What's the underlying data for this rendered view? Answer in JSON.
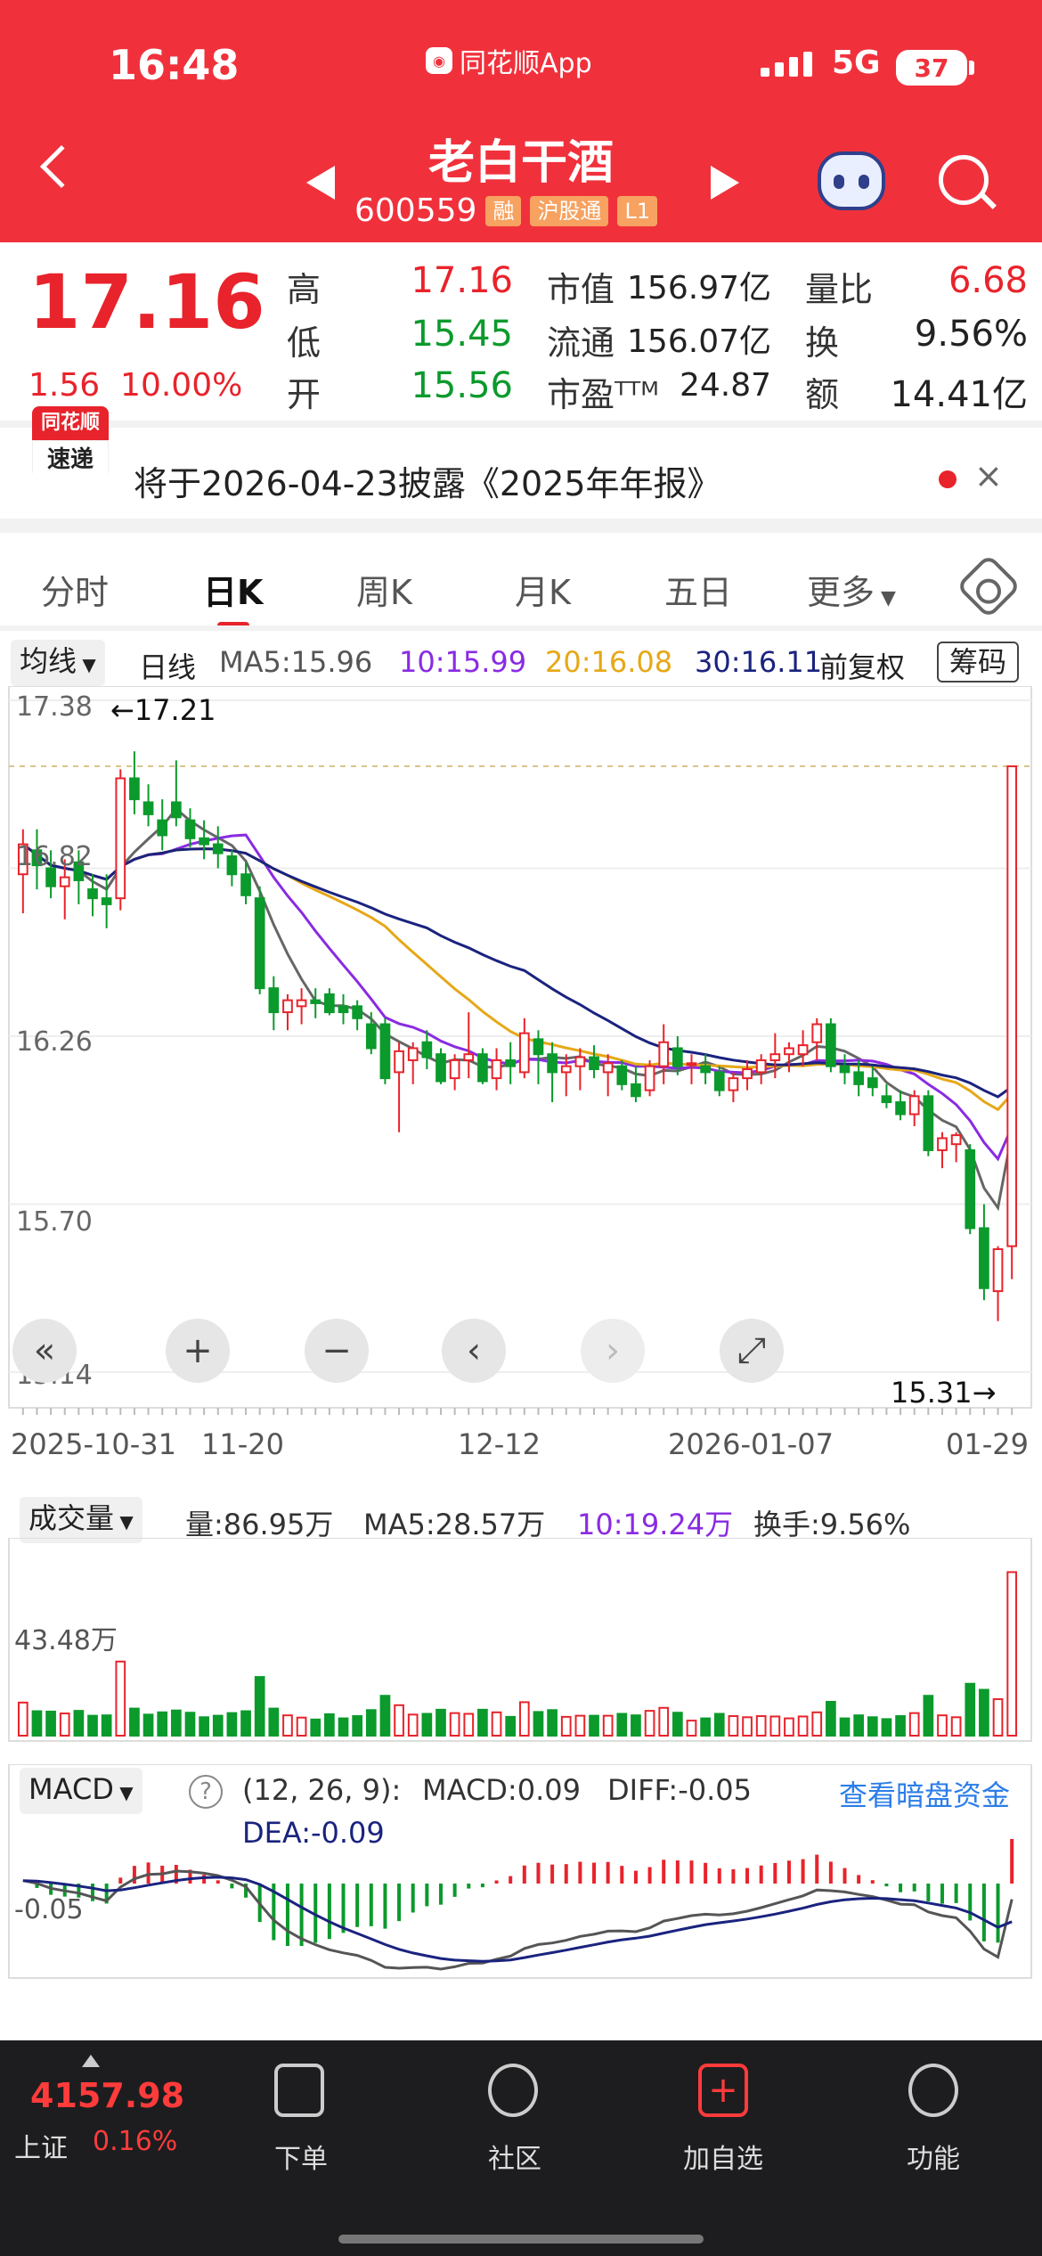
{
  "status_bar": {
    "time": "16:48",
    "app": "同花顺App",
    "network": "5G",
    "battery": "37"
  },
  "header": {
    "title": "老白干酒",
    "code": "600559",
    "tags": [
      "融",
      "沪股通",
      "L1"
    ]
  },
  "quote": {
    "price": "17.16",
    "change": "1.56",
    "change_pct": "10.00%",
    "high_label": "高",
    "high": "17.16",
    "low_label": "低",
    "low": "15.45",
    "open_label": "开",
    "open": "15.56",
    "mcap_label": "市值",
    "mcap": "156.97亿",
    "float_label": "流通",
    "float": "156.07亿",
    "pe_label": "市盈ᵀᵀᴹ",
    "pe": "24.87",
    "vr_label": "量比",
    "vr": "6.68",
    "turn_label": "换",
    "turn": "9.56%",
    "amt_label": "额",
    "amt": "14.41亿"
  },
  "announcement": {
    "logo_top": "同花顺",
    "logo_bottom": "速递",
    "text": "将于2026-04-23披露《2025年年报》",
    "close": "×"
  },
  "tabs": [
    "分时",
    "日K",
    "周K",
    "月K",
    "五日",
    "更多"
  ],
  "active_tab": "日K",
  "ma_bar": {
    "selector": "均线",
    "period": "日线",
    "ma5": "MA5:15.96",
    "ma10": "10:15.99",
    "ma20": "20:16.08",
    "ma30": "30:16.11",
    "adjust": "前复权",
    "chip_button": "筹码"
  },
  "kline_axis": {
    "y_ticks": [
      "17.38",
      "16.82",
      "16.26",
      "15.70",
      "15.14"
    ],
    "max_label": "←17.21",
    "min_label": "15.31→",
    "x_ticks": [
      "2025-10-31",
      "11-20",
      "12-12",
      "2026-01-07",
      "01-29"
    ]
  },
  "volume_bar": {
    "selector": "成交量",
    "vol": "量:86.95万",
    "ma5": "MA5:28.57万",
    "ma10": "10:19.24万",
    "turnover": "换手:9.56%",
    "y_tick": "43.48万"
  },
  "macd_bar": {
    "selector": "MACD",
    "help": "?",
    "params": "(12, 26, 9):",
    "macd": "MACD:0.09",
    "diff": "DIFF:-0.05",
    "dea": "DEA:-0.09",
    "link": "查看暗盘资金",
    "y_tick": "-0.05"
  },
  "bottom_nav": {
    "index_value": "4157.98",
    "index_name": "上证",
    "index_change": "0.16%",
    "items": [
      "下单",
      "社区",
      "加自选",
      "功能"
    ]
  },
  "colors": {
    "up": "#e8232b",
    "down": "#0b9a2c",
    "brand": "#f0313c",
    "ma5": "#666666",
    "ma10": "#8a2be2",
    "ma20": "#e6a817",
    "ma30": "#1a237e"
  },
  "chart_data": {
    "type": "candlestick",
    "candles": [
      [
        16.8,
        16.95,
        16.67,
        16.9
      ],
      [
        16.88,
        16.95,
        16.75,
        16.83
      ],
      [
        16.82,
        16.88,
        16.72,
        16.76
      ],
      [
        16.76,
        16.85,
        16.65,
        16.79
      ],
      [
        16.84,
        16.88,
        16.7,
        16.78
      ],
      [
        16.75,
        16.8,
        16.66,
        16.72
      ],
      [
        16.72,
        16.8,
        16.62,
        16.7
      ],
      [
        16.72,
        17.15,
        16.68,
        17.12
      ],
      [
        17.12,
        17.21,
        17.0,
        17.05
      ],
      [
        17.04,
        17.1,
        16.96,
        17.0
      ],
      [
        16.98,
        17.05,
        16.88,
        16.93
      ],
      [
        17.04,
        17.18,
        16.96,
        16.99
      ],
      [
        16.98,
        17.02,
        16.89,
        16.92
      ],
      [
        16.92,
        16.98,
        16.85,
        16.9
      ],
      [
        16.9,
        16.96,
        16.82,
        16.87
      ],
      [
        16.86,
        16.88,
        16.76,
        16.8
      ],
      [
        16.8,
        16.84,
        16.7,
        16.73
      ],
      [
        16.72,
        16.76,
        16.4,
        16.42
      ],
      [
        16.42,
        16.46,
        16.28,
        16.34
      ],
      [
        16.34,
        16.4,
        16.28,
        16.38
      ],
      [
        16.36,
        16.42,
        16.3,
        16.38
      ],
      [
        16.38,
        16.42,
        16.32,
        16.37
      ],
      [
        16.4,
        16.42,
        16.33,
        16.34
      ],
      [
        16.36,
        16.4,
        16.3,
        16.34
      ],
      [
        16.36,
        16.38,
        16.28,
        16.32
      ],
      [
        16.3,
        16.34,
        16.2,
        16.22
      ],
      [
        16.3,
        16.32,
        16.1,
        16.12
      ],
      [
        16.14,
        16.24,
        15.94,
        16.21
      ],
      [
        16.18,
        16.24,
        16.1,
        16.22
      ],
      [
        16.24,
        16.28,
        16.15,
        16.19
      ],
      [
        16.2,
        16.22,
        16.1,
        16.11
      ],
      [
        16.12,
        16.2,
        16.08,
        16.18
      ],
      [
        16.18,
        16.34,
        16.12,
        16.2
      ],
      [
        16.2,
        16.22,
        16.1,
        16.11
      ],
      [
        16.12,
        16.22,
        16.08,
        16.18
      ],
      [
        16.18,
        16.24,
        16.1,
        16.16
      ],
      [
        16.14,
        16.32,
        16.12,
        16.27
      ],
      [
        16.25,
        16.28,
        16.1,
        16.2
      ],
      [
        16.2,
        16.24,
        16.04,
        16.14
      ],
      [
        16.14,
        16.2,
        16.06,
        16.16
      ],
      [
        16.16,
        16.22,
        16.08,
        16.19
      ],
      [
        16.19,
        16.23,
        16.12,
        16.15
      ],
      [
        16.14,
        16.2,
        16.06,
        16.17
      ],
      [
        16.16,
        16.18,
        16.08,
        16.1
      ],
      [
        16.1,
        16.16,
        16.04,
        16.06
      ],
      [
        16.08,
        16.18,
        16.06,
        16.16
      ],
      [
        16.16,
        16.3,
        16.1,
        16.24
      ],
      [
        16.22,
        16.26,
        16.13,
        16.16
      ],
      [
        16.17,
        16.2,
        16.1,
        16.17
      ],
      [
        16.16,
        16.2,
        16.1,
        16.14
      ],
      [
        16.14,
        16.16,
        16.06,
        16.08
      ],
      [
        16.08,
        16.14,
        16.04,
        16.12
      ],
      [
        16.12,
        16.18,
        16.08,
        16.15
      ],
      [
        16.14,
        16.2,
        16.1,
        16.18
      ],
      [
        16.18,
        16.27,
        16.12,
        16.2
      ],
      [
        16.2,
        16.24,
        16.14,
        16.22
      ],
      [
        16.2,
        16.28,
        16.16,
        16.23
      ],
      [
        16.24,
        16.32,
        16.18,
        16.3
      ],
      [
        16.3,
        16.32,
        16.14,
        16.16
      ],
      [
        16.16,
        16.2,
        16.1,
        16.14
      ],
      [
        16.14,
        16.18,
        16.06,
        16.1
      ],
      [
        16.12,
        16.16,
        16.06,
        16.09
      ],
      [
        16.06,
        16.1,
        16.02,
        16.04
      ],
      [
        16.04,
        16.08,
        15.98,
        16.0
      ],
      [
        16.0,
        16.08,
        15.96,
        16.06
      ],
      [
        16.06,
        16.08,
        15.86,
        15.88
      ],
      [
        15.88,
        15.94,
        15.82,
        15.92
      ],
      [
        15.9,
        15.94,
        15.84,
        15.93
      ],
      [
        15.88,
        15.9,
        15.6,
        15.62
      ],
      [
        15.62,
        15.7,
        15.38,
        15.42
      ],
      [
        15.41,
        15.56,
        15.31,
        15.55
      ],
      [
        15.56,
        17.16,
        15.45,
        17.16
      ]
    ]
  }
}
